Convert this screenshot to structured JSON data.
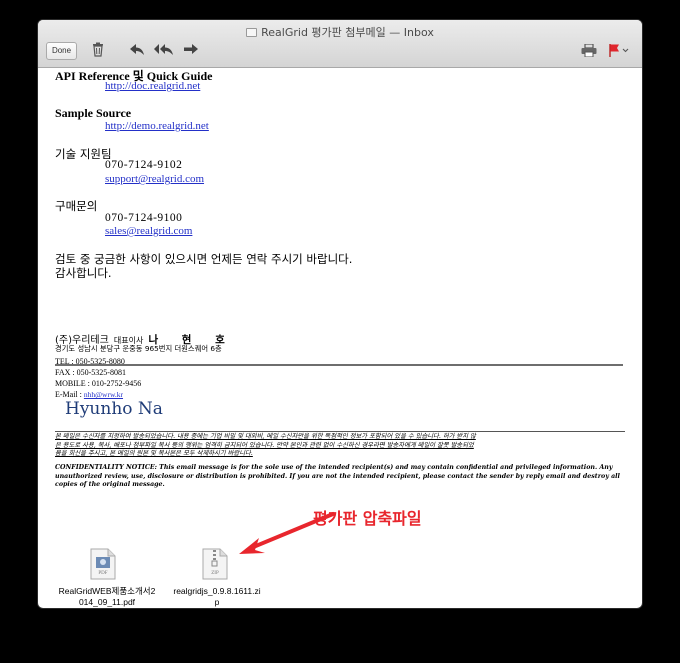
{
  "window": {
    "title": "RealGrid 평가판 첨부메일 — Inbox"
  },
  "toolbar": {
    "done_label": "Done",
    "icons": [
      "trash-icon",
      "reply-icon",
      "reply-all-icon",
      "forward-icon",
      "print-icon",
      "flag-icon"
    ]
  },
  "body": {
    "api_heading": "API Reference 및 Quick Guide",
    "api_link": "http://doc.realgrid.net",
    "sample_heading": "Sample Source",
    "sample_link": "http://demo.realgrid.net",
    "support_heading": "기술 지원팀",
    "support_phone": "070-7124-9102",
    "support_email": "support@realgrid.com",
    "purchase_heading": "구매문의",
    "purchase_phone": "070-7124-9100",
    "purchase_email": "sales@realgrid.com",
    "closing_1": "검토 중 궁금한 사항이 있으시면 언제든 연락 주시기 바랍니다.",
    "closing_2": "감사합니다."
  },
  "signature": {
    "company": "(주)우리테크",
    "ceo_title": "대표이사",
    "ceo_name": "나 현 호",
    "address": "경기도 성남시 분당구 운중동 965번지 더원스퀘어 6층",
    "tel": "TEL : 050-5325-8080",
    "fax": "FAX : 050-5325-8081",
    "mobile": "MOBILE : 010-2752-9456",
    "email_label": "E-Mail : ",
    "email": "nhh@wrw.kr",
    "handwritten": "Hyunho Na",
    "notice_kr_1": "본 메일은 수신자를 지정하여 발송되었습니다. 내용 중에는 기업 비밀 및 대외비, 메일 수신자만을 위한 독점적인 정보가 포함되어 있을 수 있습니다. 허가 받지 않",
    "notice_kr_2": "은 용도로 사용, 복사, 배포나 첨부파일 복사 등의 행위는 엄격히 금지되어 있습니다. 만약 본인과 관련 없이 수신하신 경우라면 발송자에게 메일이 잘못 발송되었",
    "notice_kr_3": "음을 회신을 주시고, 본 메일의 원본 및 복사본은 모두 삭제하시기 바랍니다.",
    "notice_en_1": "CONFIDENTIALITY NOTICE: This email message is for the sole use of the intended recipient(s) and may contain confidential and privileged information. Any",
    "notice_en_2": "unauthorized review, use, disclosure or distribution is prohibited. If you are not the intended recipient, please contact the sender by reply email and destroy all",
    "notice_en_3": "copies of the original message."
  },
  "attachments": [
    {
      "name_1": "RealGridWEB제품소개서2",
      "name_2": "014_09_11.pdf",
      "badge": "PDF"
    },
    {
      "name_1": "realgridjs_0.9.8.1611.zi",
      "name_2": "p",
      "badge": "ZIP"
    }
  ],
  "annotation": {
    "text": "평가판 압축파일",
    "color": "#e8262d"
  }
}
